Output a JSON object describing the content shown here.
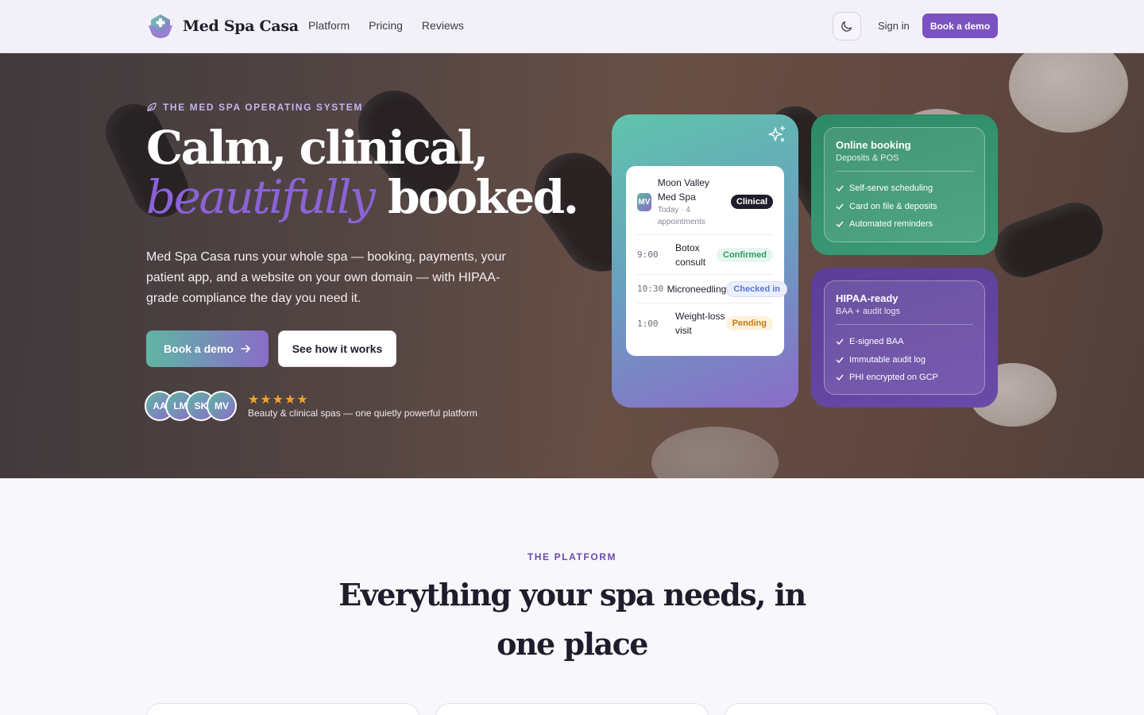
{
  "nav": {
    "brand": "Med Spa Casa",
    "links": [
      "Platform",
      "Pricing",
      "Reviews"
    ],
    "sign_in": "Sign in",
    "cta": "Book a demo",
    "theme_icon": "moon-icon"
  },
  "hero": {
    "eyebrow": "THE MED SPA OPERATING SYSTEM",
    "headline_line1": "Calm, clinical,",
    "headline_accent": "beautifully",
    "headline_end": "booked.",
    "lead": "Med Spa Casa runs your whole spa — booking, payments, your patient app, and a website on your own domain — with HIPAA-grade compliance the day you need it.",
    "primary_cta": "Book a demo",
    "secondary_cta": "See how it works",
    "avatars": [
      "AA",
      "LM",
      "SK",
      "MV"
    ],
    "stars": "★★★★★",
    "rating": 5,
    "social_proof": "Beauty & clinical spas — one quietly powerful platform"
  },
  "schedule": {
    "badge": "MV",
    "spa_name": "Moon Valley Med Spa",
    "subtitle": "Today · 4 appointments",
    "tag": "Clinical",
    "appointments": [
      {
        "time": "9:00",
        "name": "Botox consult",
        "status": "Confirmed"
      },
      {
        "time": "10:30",
        "name": "Microneedling",
        "status": "Checked in"
      },
      {
        "time": "1:00",
        "name": "Weight-loss visit",
        "status": "Pending"
      }
    ]
  },
  "features": [
    {
      "title": "Online booking",
      "subtitle": "Deposits & POS",
      "items": [
        "Self-serve scheduling",
        "Card on file & deposits",
        "Automated reminders"
      ]
    },
    {
      "title": "HIPAA-ready",
      "subtitle": "BAA + audit logs",
      "items": [
        "E-signed BAA",
        "Immutable audit log",
        "PHI encrypted on GCP"
      ]
    }
  ],
  "platform": {
    "eyebrow": "THE PLATFORM",
    "title": "Everything your spa needs, in one place"
  },
  "colors": {
    "brand_purple": "#7b52c1",
    "teal": "#5fb6a3",
    "green_card": "#2e8a66",
    "purple_card": "#5a3e97"
  }
}
